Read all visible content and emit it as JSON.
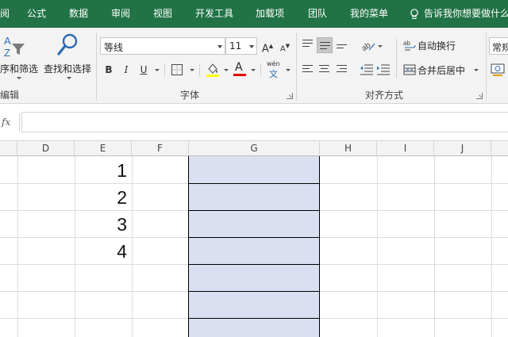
{
  "ribbon_tabs": [
    "阅",
    "公式",
    "数据",
    "审阅",
    "视图",
    "开发工具",
    "加载项",
    "团队",
    "我的菜单"
  ],
  "tell_me": "告诉我你想要做什么",
  "editing": {
    "sort_filter": "序和筛选",
    "find_select": "查找和选择",
    "group_label": "编辑"
  },
  "font": {
    "font_name": "等线",
    "font_size": "11",
    "bold": "B",
    "italic": "I",
    "underline": "U",
    "increase": "A",
    "decrease": "A",
    "font_color_glyph": "A",
    "phonetic_top": "wén",
    "phonetic_bottom": "文",
    "group_label": "字体"
  },
  "alignment": {
    "wrap_text": "自动换行",
    "merge_center": "合并后居中",
    "group_label": "对齐方式"
  },
  "number": {
    "format": "常规"
  },
  "formula_bar": {
    "fx": "fx",
    "value": ""
  },
  "sheet": {
    "columns": [
      "D",
      "E",
      "F",
      "G",
      "H",
      "I",
      "J"
    ],
    "e_values": [
      "1",
      "2",
      "3",
      "4"
    ],
    "highlight_color": "#dae0f2"
  },
  "colors": {
    "ribbon_green": "#217346",
    "font_color_bar": "#e00000"
  }
}
